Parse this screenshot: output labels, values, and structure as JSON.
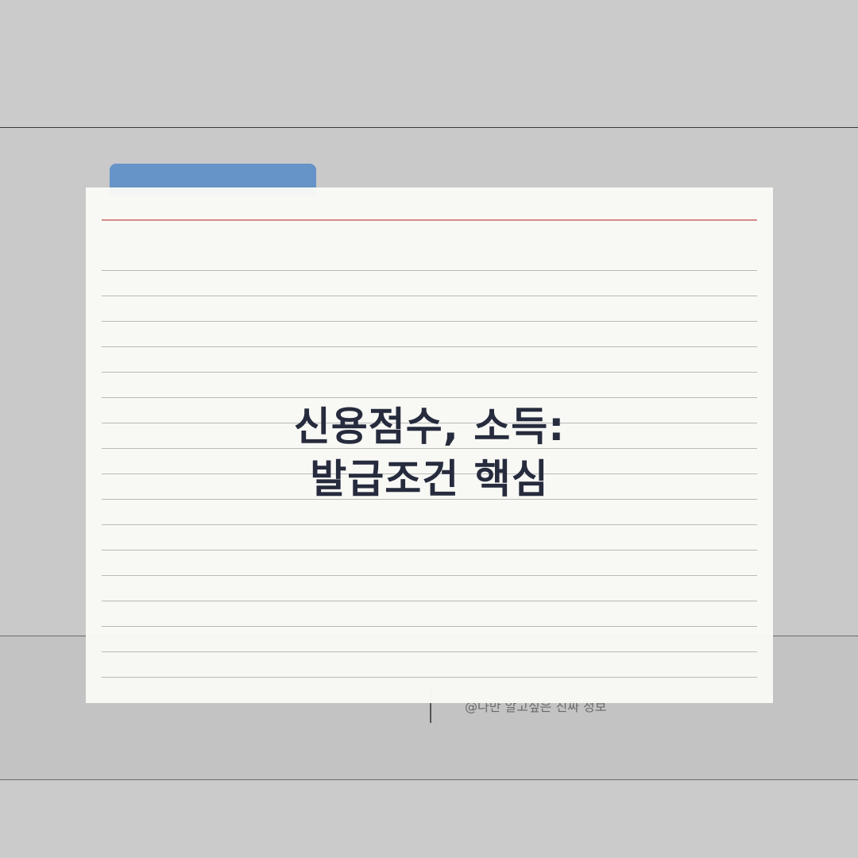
{
  "card": {
    "title_line1": "신용점수, 소득:",
    "title_line2": "발급조건 핵심"
  },
  "footer": {
    "credit": "@나만 알고싶은 진짜 정보"
  },
  "colors": {
    "background": "#cbcbcb",
    "paper": "#f9f9f6",
    "tab": "#6693c8",
    "margin_line": "#d88a8a",
    "title_text": "#262b3d"
  },
  "icons": []
}
